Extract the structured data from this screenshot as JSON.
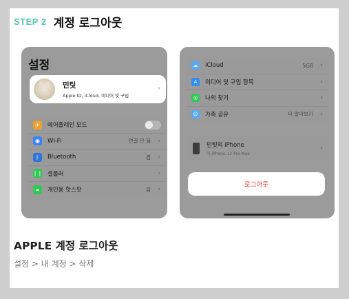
{
  "step": {
    "label": "STEP 2",
    "title": "계정 로그아웃"
  },
  "left_phone": {
    "header": "설정",
    "profile": {
      "name": "민팃",
      "subtitle": "Apple ID, iCloud, 미디어 및 구입"
    },
    "rows": [
      {
        "label": "에어플레인 모드",
        "icon": "airplane-icon",
        "color": "#f0a030",
        "glyph": "✈",
        "value": "",
        "toggle": true
      },
      {
        "label": "Wi-Fi",
        "icon": "wifi-icon",
        "color": "#3b82f6",
        "glyph": "◉",
        "value": "연결 안 됨",
        "toggle": false
      },
      {
        "label": "Bluetooth",
        "icon": "bluetooth-icon",
        "color": "#2f74d9",
        "glyph": "ᛒ",
        "value": "켬",
        "toggle": false
      },
      {
        "label": "셀룰러",
        "icon": "cellular-icon",
        "color": "#34c759",
        "glyph": "❘❘",
        "value": "",
        "toggle": false
      },
      {
        "label": "개인용 핫스팟",
        "icon": "hotspot-icon",
        "color": "#34c759",
        "glyph": "∞",
        "value": "끔",
        "toggle": false
      }
    ]
  },
  "right_phone": {
    "rows": [
      {
        "label": "iCloud",
        "icon": "icloud-icon",
        "color": "#5aa9f5",
        "glyph": "☁",
        "value": "5GB"
      },
      {
        "label": "미디어 및 구입 항목",
        "icon": "app-store-icon",
        "color": "#2f8cf0",
        "glyph": "A",
        "value": ""
      },
      {
        "label": "나의 찾기",
        "icon": "find-my-icon",
        "color": "#34c759",
        "glyph": "◎",
        "value": ""
      },
      {
        "label": "가족 공유",
        "icon": "family-sharing-icon",
        "color": "#5aa9f5",
        "glyph": "☺",
        "value": "더 알아보기"
      }
    ],
    "device": {
      "name": "민팃의 iPhone",
      "model": "이 iPhone 12 Pro Max"
    },
    "logout_label": "로그아웃"
  },
  "main_title": "APPLE 계정 로그아웃",
  "breadcrumb": "설정 > 내 계정 > 삭제"
}
